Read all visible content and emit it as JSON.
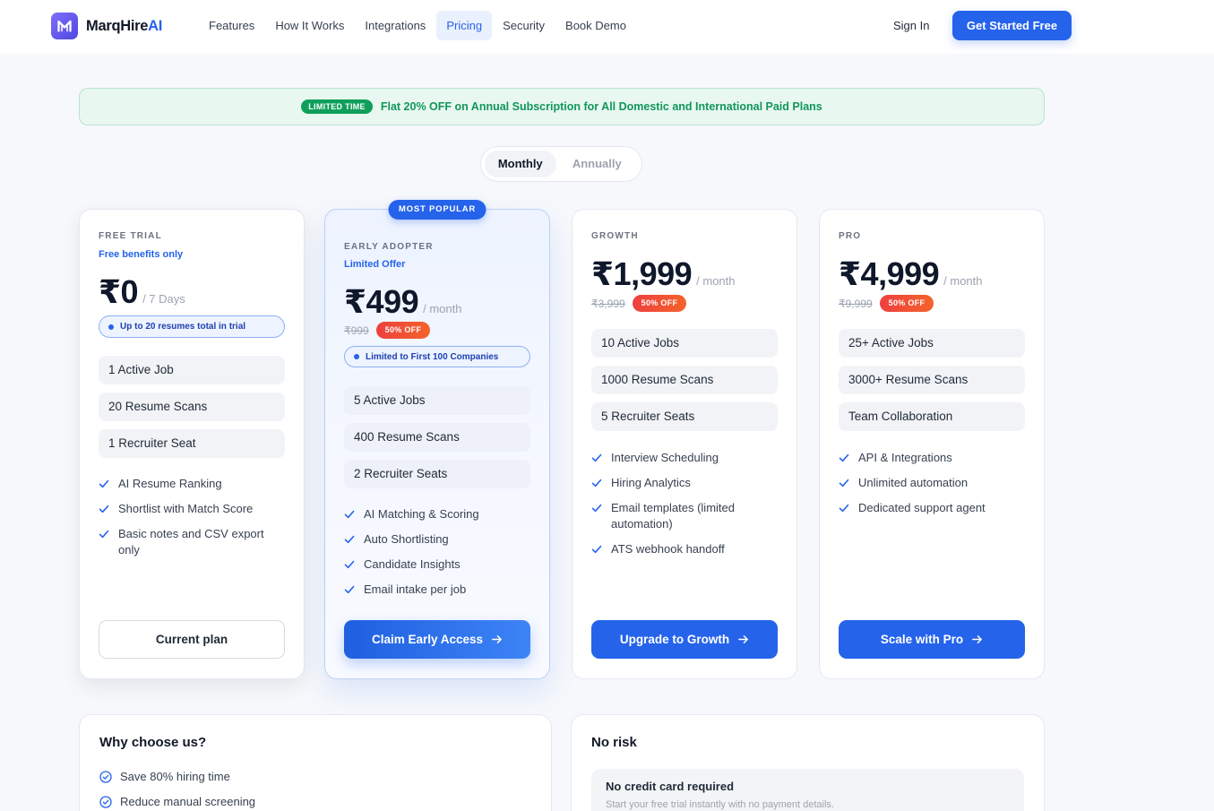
{
  "brand": {
    "name_main": "MarqHire",
    "name_accent": "AI"
  },
  "nav": {
    "items": [
      {
        "label": "Features",
        "active": false
      },
      {
        "label": "How It Works",
        "active": false
      },
      {
        "label": "Integrations",
        "active": false
      },
      {
        "label": "Pricing",
        "active": true
      },
      {
        "label": "Security",
        "active": false
      },
      {
        "label": "Book Demo",
        "active": false
      }
    ]
  },
  "header_actions": {
    "sign_in": "Sign In",
    "cta": "Get Started Free"
  },
  "promo_banner": {
    "badge": "LIMITED TIME",
    "text": "Flat 20% OFF on Annual Subscription for All Domestic and International Paid Plans"
  },
  "billing_toggle": {
    "options": [
      {
        "label": "Monthly",
        "selected": true
      },
      {
        "label": "Annually",
        "selected": false
      }
    ]
  },
  "plans": [
    {
      "tier": "FREE TRIAL",
      "subtitle": "Free benefits only",
      "price": "₹0",
      "period": "/ 7 Days",
      "highlight": "Up to 20 resumes total in trial",
      "limits": [
        "1 Active Job",
        "20 Resume Scans",
        "1 Recruiter Seat"
      ],
      "features": [
        "AI Resume Ranking",
        "Shortlist with Match Score",
        "Basic notes and CSV export only"
      ],
      "button": "Current plan",
      "featured": false
    },
    {
      "badge": "MOST POPULAR",
      "tier": "EARLY ADOPTER",
      "subtitle": "Limited Offer",
      "price": "₹499",
      "period": "/ month",
      "original_price": "₹999",
      "discount": "50% OFF",
      "highlight": "Limited to First 100 Companies",
      "limits": [
        "5 Active Jobs",
        "400 Resume Scans",
        "2 Recruiter Seats"
      ],
      "features": [
        "AI Matching & Scoring",
        "Auto Shortlisting",
        "Candidate Insights",
        "Email intake per job"
      ],
      "button": "Claim Early Access",
      "featured": true
    },
    {
      "tier": "GROWTH",
      "price": "₹1,999",
      "period": "/ month",
      "original_price": "₹3,999",
      "discount": "50% OFF",
      "limits": [
        "10 Active Jobs",
        "1000 Resume Scans",
        "5 Recruiter Seats"
      ],
      "features": [
        "Interview Scheduling",
        "Hiring Analytics",
        "Email templates (limited automation)",
        "ATS webhook handoff"
      ],
      "button": "Upgrade to Growth",
      "featured": false
    },
    {
      "tier": "PRO",
      "price": "₹4,999",
      "period": "/ month",
      "original_price": "₹9,999",
      "discount": "50% OFF",
      "limits": [
        "25+ Active Jobs",
        "3000+ Resume Scans",
        "Team Collaboration"
      ],
      "features": [
        "API & Integrations",
        "Unlimited automation",
        "Dedicated support agent"
      ],
      "button": "Scale with Pro",
      "featured": false
    }
  ],
  "why_choose": {
    "title": "Why choose us?",
    "items": [
      "Save 80% hiring time",
      "Reduce manual screening"
    ]
  },
  "no_risk": {
    "title": "No risk",
    "items": [
      {
        "title": "No credit card required",
        "description": "Start your free trial instantly with no payment details."
      }
    ]
  },
  "icons": {
    "brand_logo": "marqhire-logo-icon",
    "feature_check": "check-icon",
    "button_arrow": "arrow-right-icon",
    "benefit_check": "circle-check-icon",
    "highlight_dot": "dot-icon"
  },
  "colors": {
    "accent": "#2563eb",
    "success": "#0f9f5b",
    "discount": "#ef4b2b",
    "page_background": "#f6f8fb"
  }
}
